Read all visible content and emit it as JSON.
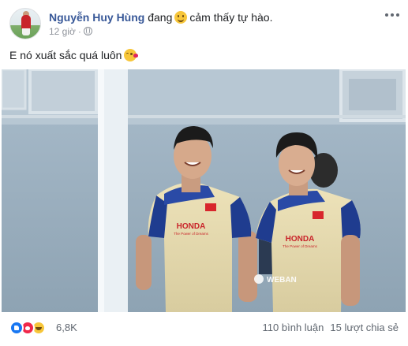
{
  "post": {
    "author": "Nguyễn Huy Hùng",
    "feeling_prefix": "đang",
    "feeling_icon": "smile-emoji-icon",
    "feeling": "cảm thấy tự hào.",
    "time": "12 giờ",
    "separator": "·",
    "privacy_icon": "globe-icon",
    "more_icon": "more-options-icon",
    "text": "E nó xuất sắc quá luôn",
    "text_emoji": "kiss-emoji-icon"
  },
  "photo": {
    "watermark": "WEBAN",
    "jersey_sponsor": "HONDA",
    "jersey_tagline": "The Power of Dreams"
  },
  "reactions": {
    "icons": [
      "like-icon",
      "love-icon",
      "haha-icon"
    ],
    "count": "6,8K"
  },
  "engagement": {
    "comments": "110 bình luận",
    "shares": "15 lượt chia sẻ"
  },
  "colors": {
    "author_link": "#385898",
    "meta_text": "#90949c",
    "like": "#1877f2",
    "love": "#f0284a",
    "haha": "#f7c63a"
  }
}
